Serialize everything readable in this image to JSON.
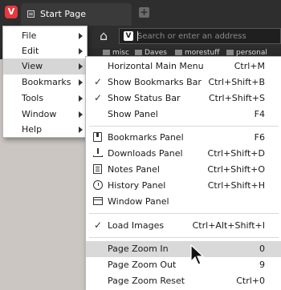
{
  "tabs": [
    {
      "label": "Start Page"
    }
  ],
  "logo_letter": "V",
  "address_bar": {
    "placeholder": "Search or enter an address"
  },
  "bookmarks_bar": [
    {
      "label": "misc"
    },
    {
      "label": "Daves"
    },
    {
      "label": "morestuff"
    },
    {
      "label": "personal"
    }
  ],
  "main_menu": [
    {
      "label": "File",
      "has_submenu": true
    },
    {
      "label": "Edit",
      "has_submenu": true
    },
    {
      "label": "View",
      "has_submenu": true,
      "active": true
    },
    {
      "label": "Bookmarks",
      "has_submenu": true
    },
    {
      "label": "Tools",
      "has_submenu": true
    },
    {
      "label": "Window",
      "has_submenu": true
    },
    {
      "label": "Help",
      "has_submenu": true
    }
  ],
  "view_menu": [
    {
      "label": "Horizontal Main Menu",
      "shortcut": "Ctrl+M",
      "icon": ""
    },
    {
      "label": "Show Bookmarks Bar",
      "shortcut": "Ctrl+Shift+B",
      "icon": "check-icon",
      "checked": true
    },
    {
      "label": "Show Status Bar",
      "shortcut": "Ctrl+Shift+S",
      "icon": "check-icon",
      "checked": true
    },
    {
      "label": "Show Panel",
      "shortcut": "F4",
      "icon": ""
    },
    {
      "label": "Bookmarks Panel",
      "shortcut": "F6",
      "icon": "bookmark-icon"
    },
    {
      "label": "Downloads Panel",
      "shortcut": "Ctrl+Shift+D",
      "icon": "download-icon"
    },
    {
      "label": "Notes Panel",
      "shortcut": "Ctrl+Shift+O",
      "icon": "notes-icon"
    },
    {
      "label": "History Panel",
      "shortcut": "Ctrl+Shift+H",
      "icon": "history-icon"
    },
    {
      "label": "Window Panel",
      "shortcut": "",
      "icon": "window-icon"
    },
    {
      "label": "Load Images",
      "shortcut": "Ctrl+Alt+Shift+I",
      "icon": "check-icon",
      "checked": true
    },
    {
      "label": "Page Zoom In",
      "shortcut": "0",
      "icon": "",
      "hovered": true
    },
    {
      "label": "Page Zoom Out",
      "shortcut": "9",
      "icon": ""
    },
    {
      "label": "Page Zoom Reset",
      "shortcut": "Ctrl+0",
      "icon": ""
    }
  ],
  "colors": {
    "chrome": "#2e2e2e",
    "logo": "#e8383d",
    "menu_highlight": "#d9d9d9"
  }
}
